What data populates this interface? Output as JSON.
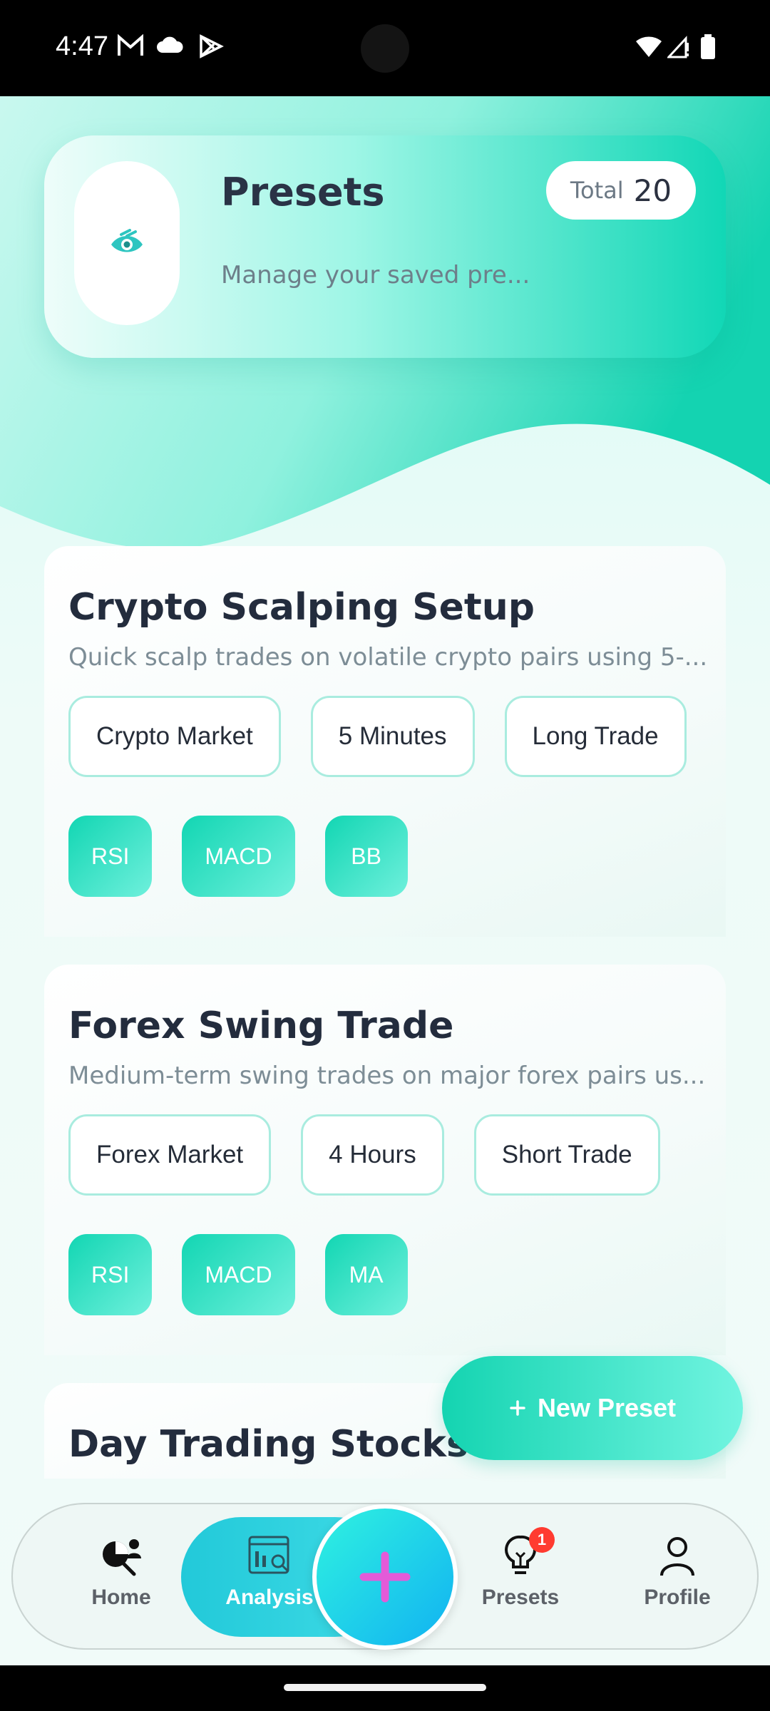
{
  "status_bar": {
    "time": "4:47",
    "left_icons": [
      "gmail-icon",
      "cloud-icon",
      "play-store-icon"
    ],
    "right_icons": [
      "wifi-icon",
      "signal-icon",
      "battery-icon"
    ]
  },
  "header": {
    "title": "Presets",
    "subtitle": "Manage your saved pre...",
    "total_label": "Total",
    "total_value": "20",
    "icon": "eye-icon"
  },
  "presets": [
    {
      "title": "Crypto Scalping Setup",
      "description": "Quick scalp trades on volatile crypto pairs using 5-...",
      "tags": [
        "Crypto Market",
        "5 Minutes",
        "Long Trade"
      ],
      "indicators": [
        "RSI",
        "MACD",
        "BB"
      ]
    },
    {
      "title": "Forex Swing Trade",
      "description": "Medium-term swing trades on major forex pairs us...",
      "tags": [
        "Forex Market",
        "4 Hours",
        "Short Trade"
      ],
      "indicators": [
        "RSI",
        "MACD",
        "MA"
      ]
    },
    {
      "title": "Day Trading Stocks"
    }
  ],
  "new_preset_button": {
    "label": "New Preset",
    "icon": "plus-icon"
  },
  "bottom_nav": {
    "items": [
      {
        "label": "Home",
        "icon": "analytics-user-icon"
      },
      {
        "label": "Analysis",
        "icon": "dashboard-search-icon",
        "active": true
      },
      {
        "label": "Presets",
        "icon": "lightbulb-icon",
        "badge": "1"
      },
      {
        "label": "Profile",
        "icon": "person-icon"
      }
    ],
    "center_icon": "plus-icon"
  },
  "colors": {
    "accent": "#14d4b1",
    "accent_light": "#71f4e0",
    "nav_active": "#22c9d9",
    "center_plus": "#e45bd8",
    "text_dark": "#232c3d"
  }
}
